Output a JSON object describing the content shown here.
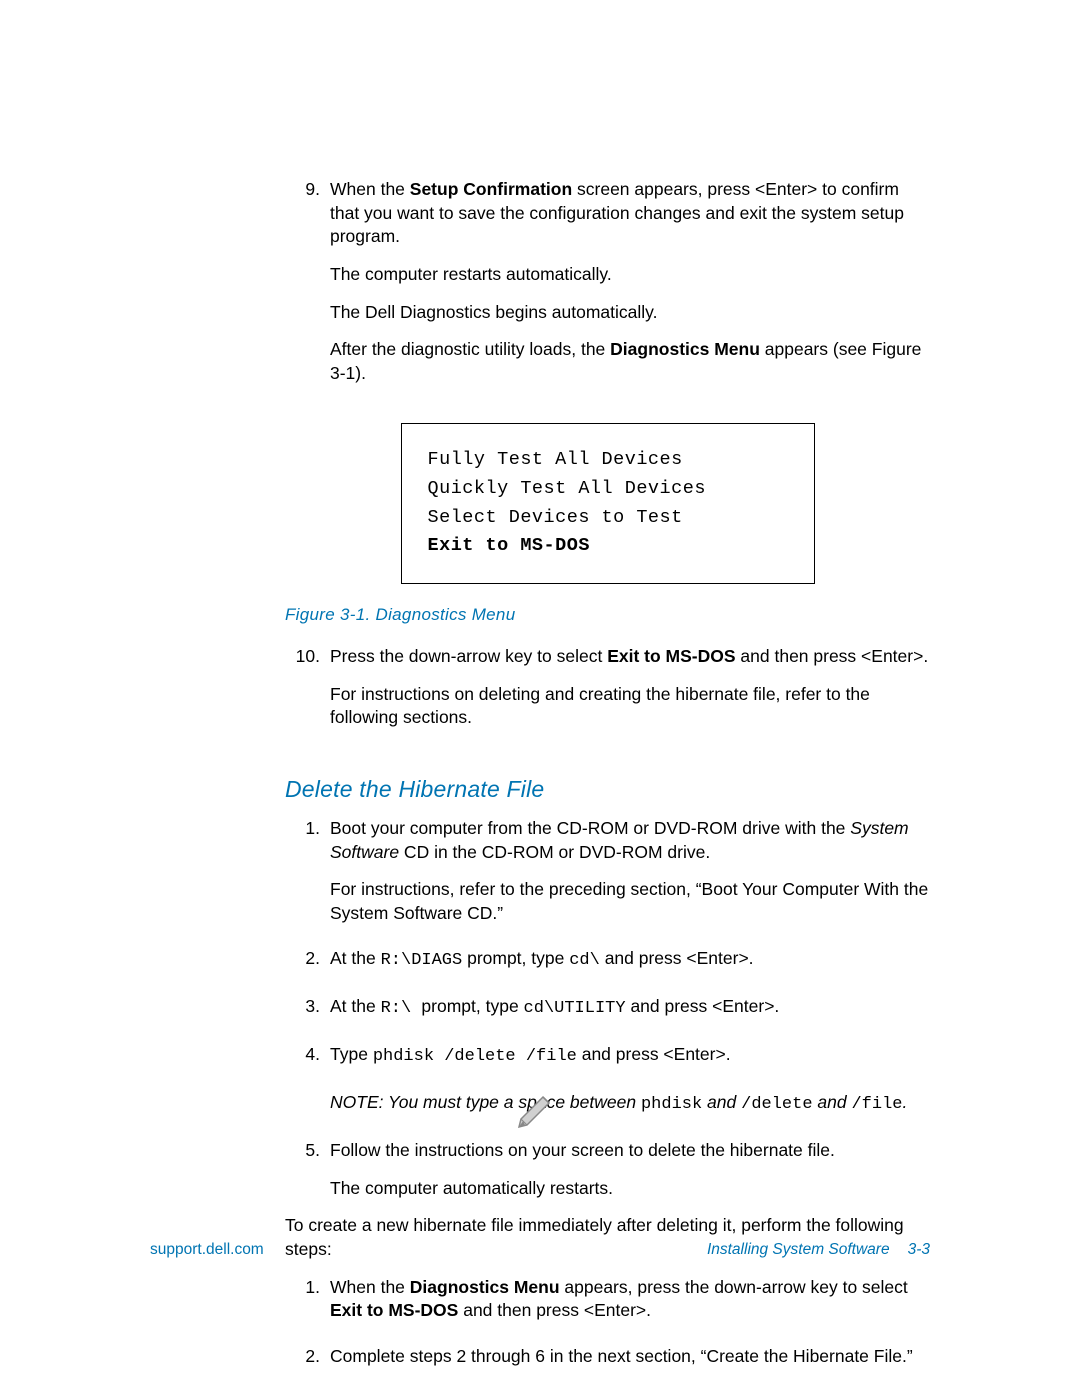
{
  "step9": {
    "num": "9.",
    "line1a": "When the ",
    "bold1": "Setup Confirmation",
    "line1b": " screen appears, press <Enter> to confirm that you want to save the configuration changes and exit the system setup program.",
    "p2": "The computer restarts automatically.",
    "p3": "The Dell Diagnostics begins automatically.",
    "p4a": "After the diagnostic utility loads, the ",
    "p4bold": "Diagnostics Menu",
    "p4b": " appears (see Figure 3-1)."
  },
  "menu": {
    "l1": "Fully Test All Devices",
    "l2": "Quickly Test All Devices",
    "l3": "Select Devices to Test",
    "l4": "Exit to MS-DOS"
  },
  "figcap": "Figure 3-1.  Diagnostics Menu",
  "step10": {
    "num": "10.",
    "t1": "Press the down-arrow key to select ",
    "bold": "Exit to MS-DOS",
    "t2": " and then press <Enter>.",
    "p2": "For instructions on deleting and creating the hibernate file, refer to the following sections."
  },
  "h2": "Delete the Hibernate File",
  "d1": {
    "num": "1.",
    "t1": "Boot your computer from the CD-ROM or DVD-ROM drive with the ",
    "ital": "System Software",
    "t2": " CD in the CD-ROM or DVD-ROM drive.",
    "p2": "For instructions, refer to the preceding section, “Boot Your Computer With the System Software CD.”"
  },
  "d2": {
    "num": "2.",
    "t1": "At the ",
    "m1": "R:\\DIAGS",
    "t2": " prompt, type ",
    "m2": "cd\\",
    "t3": " and press <Enter>."
  },
  "d3": {
    "num": "3.",
    "t1": "At the ",
    "m1": "R:\\ ",
    "t2": " prompt, type ",
    "m2": "cd\\UTILITY",
    "t3": " and press <Enter>."
  },
  "d4": {
    "num": "4.",
    "t1": "Type ",
    "m1": "phdisk /delete /file",
    "t2": " and press <Enter>."
  },
  "note": {
    "t1": "NOTE: You must type a space between ",
    "m1": "phdisk",
    "t2": "  and  ",
    "m2": "/delete",
    "t3": " and ",
    "m3": "/file",
    "t4": "."
  },
  "d5": {
    "num": "5.",
    "t1": "Follow the instructions on your screen to delete the hibernate file.",
    "p2": "The computer automatically restarts."
  },
  "plain": "To create a new hibernate file immediately after deleting it, perform the following steps:",
  "c1": {
    "num": "1.",
    "t1": "When the ",
    "bold1": "Diagnostics Menu",
    "t2": " appears, press the down-arrow key to select ",
    "bold2": "Exit to MS-DOS",
    "t3": " and then press <Enter>."
  },
  "c2": {
    "num": "2.",
    "t1": "Complete steps 2 through 6 in the next section, “Create the Hibernate File.”"
  },
  "footer": {
    "left": "support.dell.com",
    "right": "Installing System Software",
    "page": "3-3"
  }
}
